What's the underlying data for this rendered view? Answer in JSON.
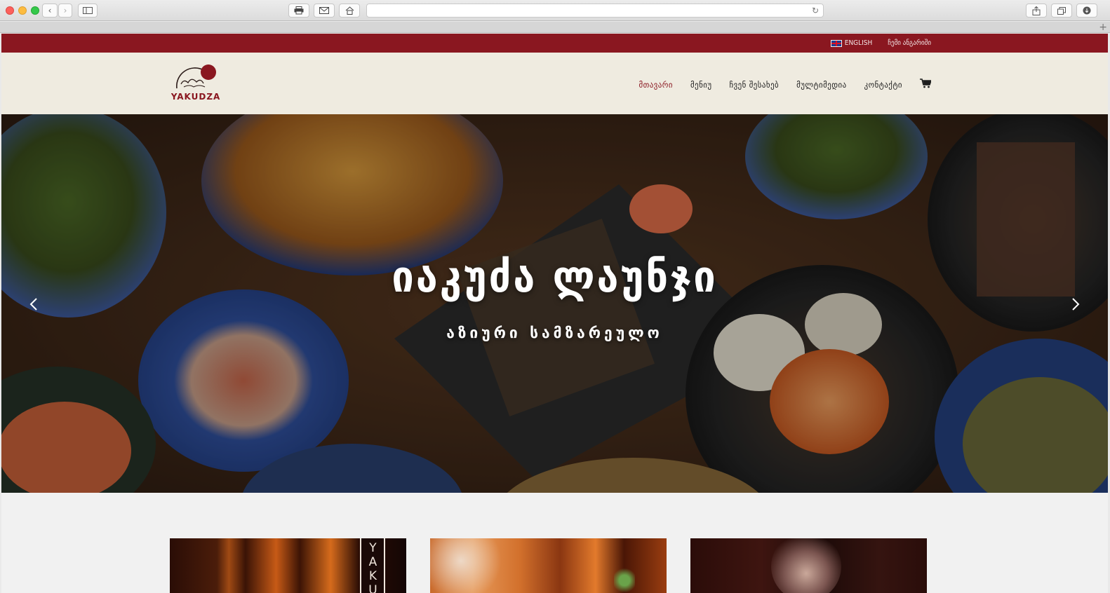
{
  "browser": {
    "icons": [
      "back-icon",
      "forward-icon",
      "sidebar-icon",
      "print-icon",
      "mail-icon",
      "home-icon",
      "reload-icon",
      "share-icon",
      "tabs-icon",
      "download-icon",
      "new-tab-icon"
    ]
  },
  "topbar": {
    "lang_english": "ENGLISH",
    "my_account": "ჩემი ანგარიში",
    "bg_color": "#8a1720"
  },
  "header": {
    "logo_text": "YAKUDZA",
    "nav": [
      {
        "label": "მთავარი",
        "active": true
      },
      {
        "label": "მენიუ",
        "active": false
      },
      {
        "label": "ჩვენ შესახებ",
        "active": false
      },
      {
        "label": "მულტიმედია",
        "active": false
      },
      {
        "label": "კონტაქტი",
        "active": false
      }
    ],
    "cart_icon": "shopping-cart-icon"
  },
  "hero": {
    "title": "იაკუძა ლაუნჯი",
    "subtitle": "აზიური სამზარეულო"
  },
  "cards": {
    "card1_vertical_text": "YAKU"
  },
  "colors": {
    "accent": "#8a1720",
    "header_bg": "#efebe0"
  }
}
